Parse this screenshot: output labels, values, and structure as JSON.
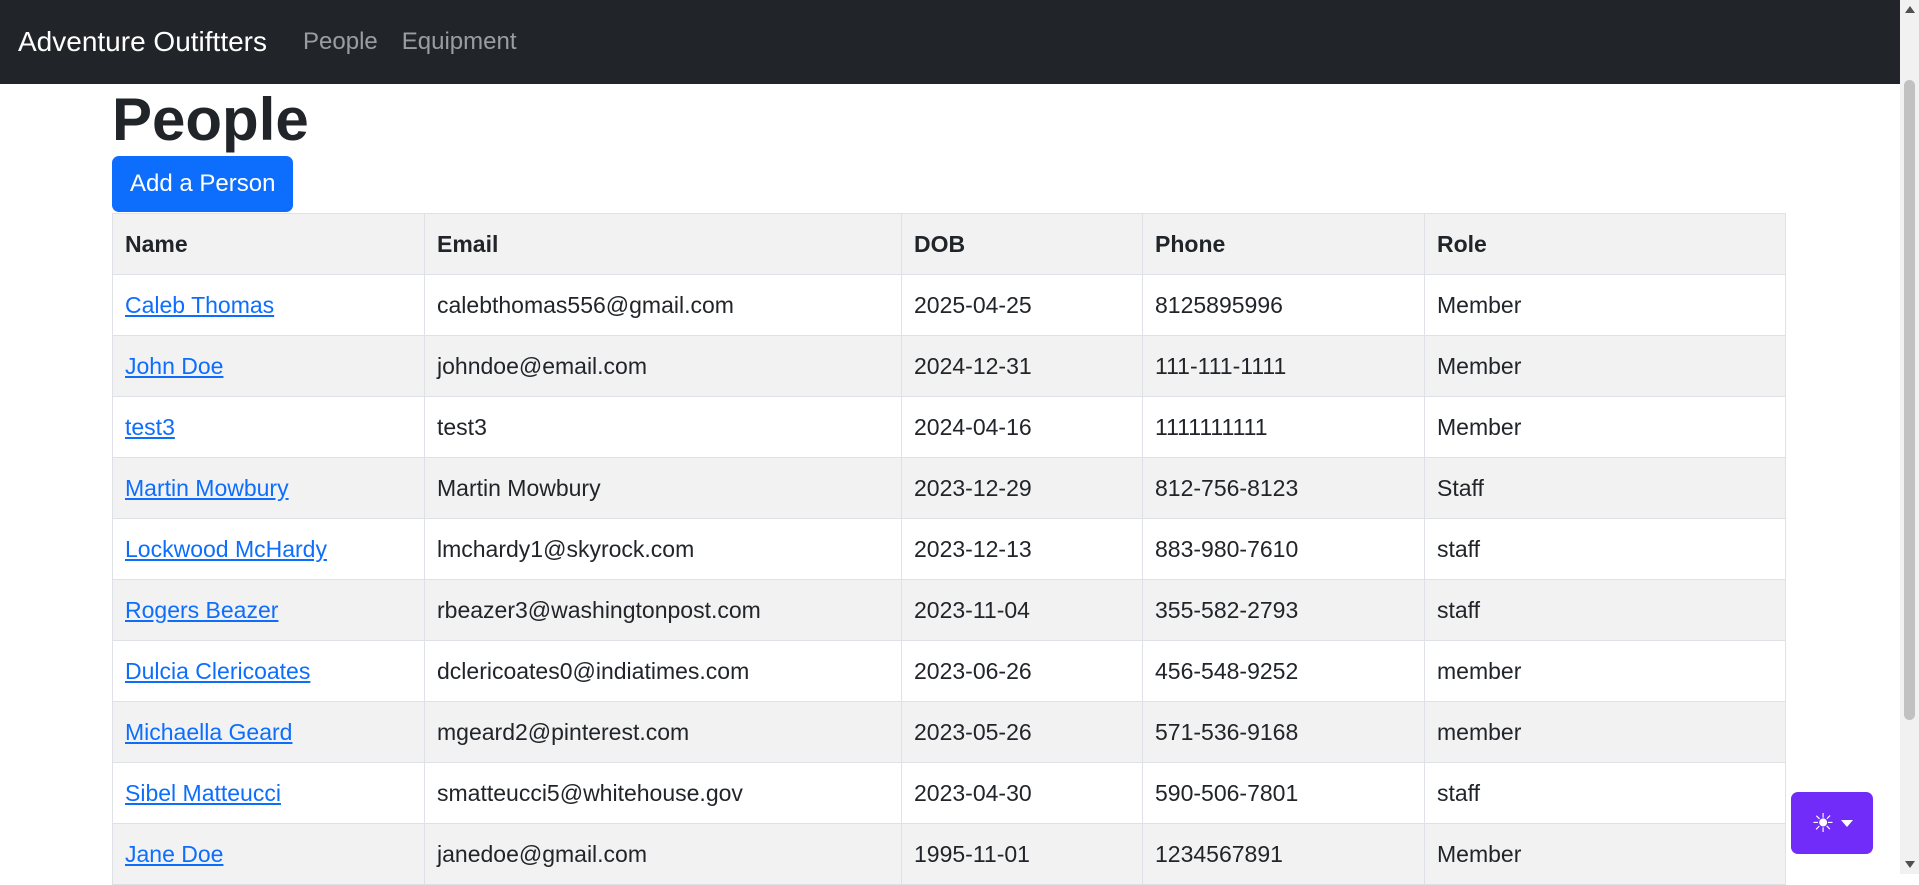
{
  "navbar": {
    "brand": "Adventure Outiftters",
    "links": [
      "People",
      "Equipment"
    ]
  },
  "page": {
    "title": "People",
    "add_button": "Add a Person"
  },
  "table": {
    "headers": [
      "Name",
      "Email",
      "DOB",
      "Phone",
      "Role"
    ],
    "rows": [
      {
        "name": "Caleb Thomas",
        "email": "calebthomas556@gmail.com",
        "dob": "2025-04-25",
        "phone": "8125895996",
        "role": "Member"
      },
      {
        "name": "John Doe",
        "email": "johndoe@email.com",
        "dob": "2024-12-31",
        "phone": "111-111-1111",
        "role": "Member"
      },
      {
        "name": "test3",
        "email": "test3",
        "dob": "2024-04-16",
        "phone": "1111111111",
        "role": "Member"
      },
      {
        "name": "Martin Mowbury",
        "email": "Martin Mowbury",
        "dob": "2023-12-29",
        "phone": "812-756-8123",
        "role": "Staff"
      },
      {
        "name": "Lockwood McHardy",
        "email": "lmchardy1@skyrock.com",
        "dob": "2023-12-13",
        "phone": "883-980-7610",
        "role": "staff"
      },
      {
        "name": "Rogers Beazer",
        "email": "rbeazer3@washingtonpost.com",
        "dob": "2023-11-04",
        "phone": "355-582-2793",
        "role": "staff"
      },
      {
        "name": "Dulcia Clericoates",
        "email": "dclericoates0@indiatimes.com",
        "dob": "2023-06-26",
        "phone": "456-548-9252",
        "role": "member"
      },
      {
        "name": "Michaella Geard",
        "email": "mgeard2@pinterest.com",
        "dob": "2023-05-26",
        "phone": "571-536-9168",
        "role": "member"
      },
      {
        "name": "Sibel Matteucci",
        "email": "smatteucci5@whitehouse.gov",
        "dob": "2023-04-30",
        "phone": "590-506-7801",
        "role": "staff"
      },
      {
        "name": "Jane Doe",
        "email": "janedoe@gmail.com",
        "dob": "1995-11-01",
        "phone": "1234567891",
        "role": "Member"
      }
    ]
  },
  "theme_toggle": {
    "icon": "sun-icon",
    "glyph": "☀",
    "color": "#712cf9"
  },
  "colors": {
    "navbar_bg": "#212529",
    "primary": "#0d6efd"
  }
}
